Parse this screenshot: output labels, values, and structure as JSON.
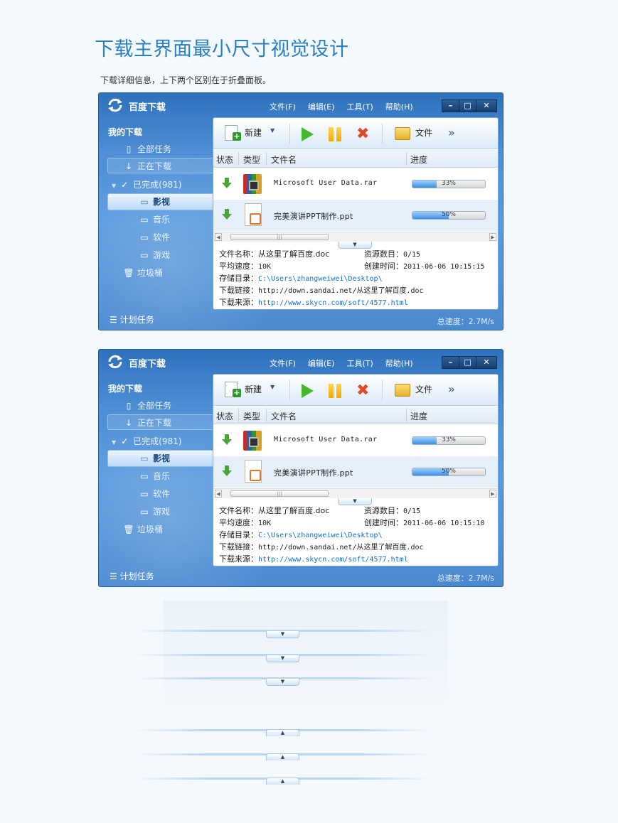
{
  "page": {
    "title": "下载主界面最小尺寸视觉设计",
    "subtitle": "下载详细信息，上下两个区别在于折叠面板。"
  },
  "app": {
    "title": "百度下载",
    "menu": [
      "文件(F)",
      "编辑(E)",
      "工具(T)",
      "帮助(H)"
    ],
    "window_buttons": [
      "–",
      "□",
      "✕"
    ]
  },
  "sidebar": {
    "heading": "我的下载",
    "items": [
      {
        "label": "全部任务",
        "icon": "document-icon"
      },
      {
        "label": "正在下载",
        "icon": "download-arrow-icon"
      },
      {
        "label": "已完成(981)",
        "icon": "checkmark-icon"
      },
      {
        "label": "影视",
        "icon": "folder-icon"
      },
      {
        "label": "音乐",
        "icon": "folder-icon"
      },
      {
        "label": "软件",
        "icon": "folder-icon"
      },
      {
        "label": "游戏",
        "icon": "folder-icon"
      },
      {
        "label": "垃圾桶",
        "icon": "trash-icon"
      }
    ],
    "plan": "计划任务"
  },
  "toolbar": {
    "new_label": "新建",
    "file_label": "文件",
    "more": "»"
  },
  "table": {
    "headers": [
      "状态",
      "类型",
      "文件名",
      "进度"
    ],
    "rows": [
      {
        "name": "Microsoft User Data.rar",
        "progress": "33%",
        "progress_value": 0.33,
        "type_icon": "rar-archive-icon"
      },
      {
        "name": "完美演讲PPT制作.ppt",
        "progress": "50%",
        "progress_value": 0.5,
        "type_icon": "ppt-file-icon"
      }
    ]
  },
  "details_top": {
    "name_label": "文件名称：",
    "name": "从这里了解百度.doc",
    "sources_label": "资源数目：",
    "sources": "0/15",
    "speed_label": "平均速度：",
    "speed": "10K",
    "created_label": "创建时间：",
    "created": "2011-06-06 10:15:15",
    "dir_label": "存储目录：",
    "dir": "C:\\Users\\zhangweiwei\\Desktop\\",
    "link_label": "下载链接：",
    "link": "http://down.sandai.net/从这里了解百度.doc",
    "source_label": "下载来源：",
    "source": "http://www.skycn.com/soft/4577.html"
  },
  "details_bottom": {
    "created": "2011-06-06 10:15:10"
  },
  "status": {
    "total_speed_label": "总速度：",
    "total_speed": "2.7M/s"
  },
  "colors": {
    "title": "#2a7fc2",
    "window_blue": "#4e8fd5",
    "link": "#1a6fc1"
  }
}
